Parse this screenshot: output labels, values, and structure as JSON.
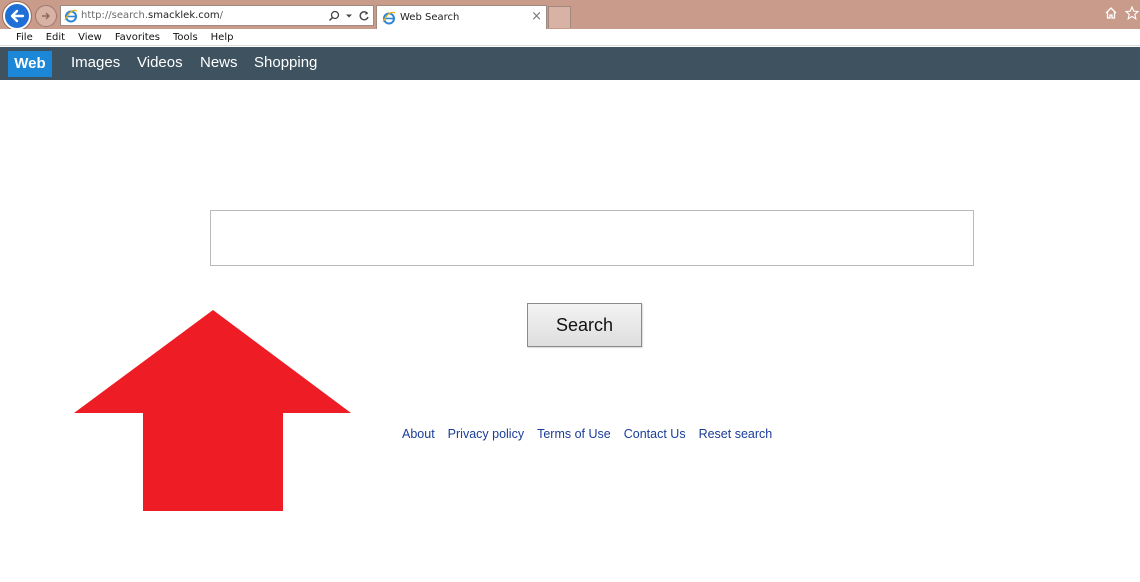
{
  "browser": {
    "url_prefix": "http://search.",
    "url_domain": "smacklek.com",
    "url_suffix": "/",
    "tab_title": "Web Search",
    "tab_close": "×",
    "menu": [
      "File",
      "Edit",
      "View",
      "Favorites",
      "Tools",
      "Help"
    ]
  },
  "site_nav": {
    "items": [
      "Web",
      "Images",
      "Videos",
      "News",
      "Shopping"
    ],
    "active": "Web"
  },
  "search": {
    "input_value": "",
    "button_label": "Search"
  },
  "footer": {
    "links": [
      "About",
      "Privacy policy",
      "Terms of Use",
      "Contact Us",
      "Reset search"
    ]
  },
  "annotation": {
    "shape": "up-arrow",
    "color": "#ee1c24"
  },
  "colors": {
    "titlebar": "#c99b8a",
    "nav_bar": "#3e5260",
    "nav_active": "#1b87d6",
    "link": "#1a3d9a"
  }
}
